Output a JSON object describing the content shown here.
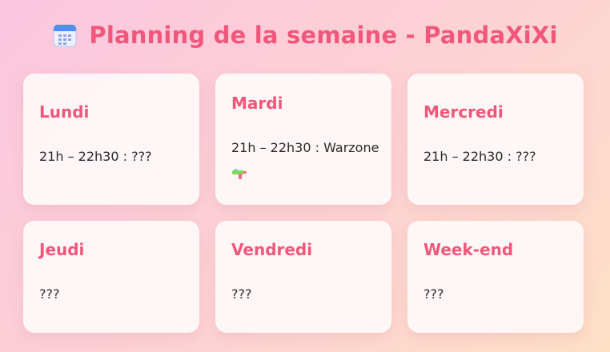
{
  "header": {
    "icon": "calendar-icon",
    "title": "Planning de la semaine - PandaXiXi"
  },
  "schedule": [
    {
      "day": "Lundi",
      "desc": "21h – 22h30 : ???"
    },
    {
      "day": "Mardi",
      "desc": "21h – 22h30 : Warzone",
      "icon": "water-pistol-icon"
    },
    {
      "day": "Mercredi",
      "desc": "21h – 22h30 : ???"
    },
    {
      "day": "Jeudi",
      "desc": "???"
    },
    {
      "day": "Vendredi",
      "desc": "???"
    },
    {
      "day": "Week-end",
      "desc": "???"
    }
  ],
  "colors": {
    "accent": "#f0577b",
    "card_bg": "#fff8f8",
    "text": "#2b2b2b"
  }
}
